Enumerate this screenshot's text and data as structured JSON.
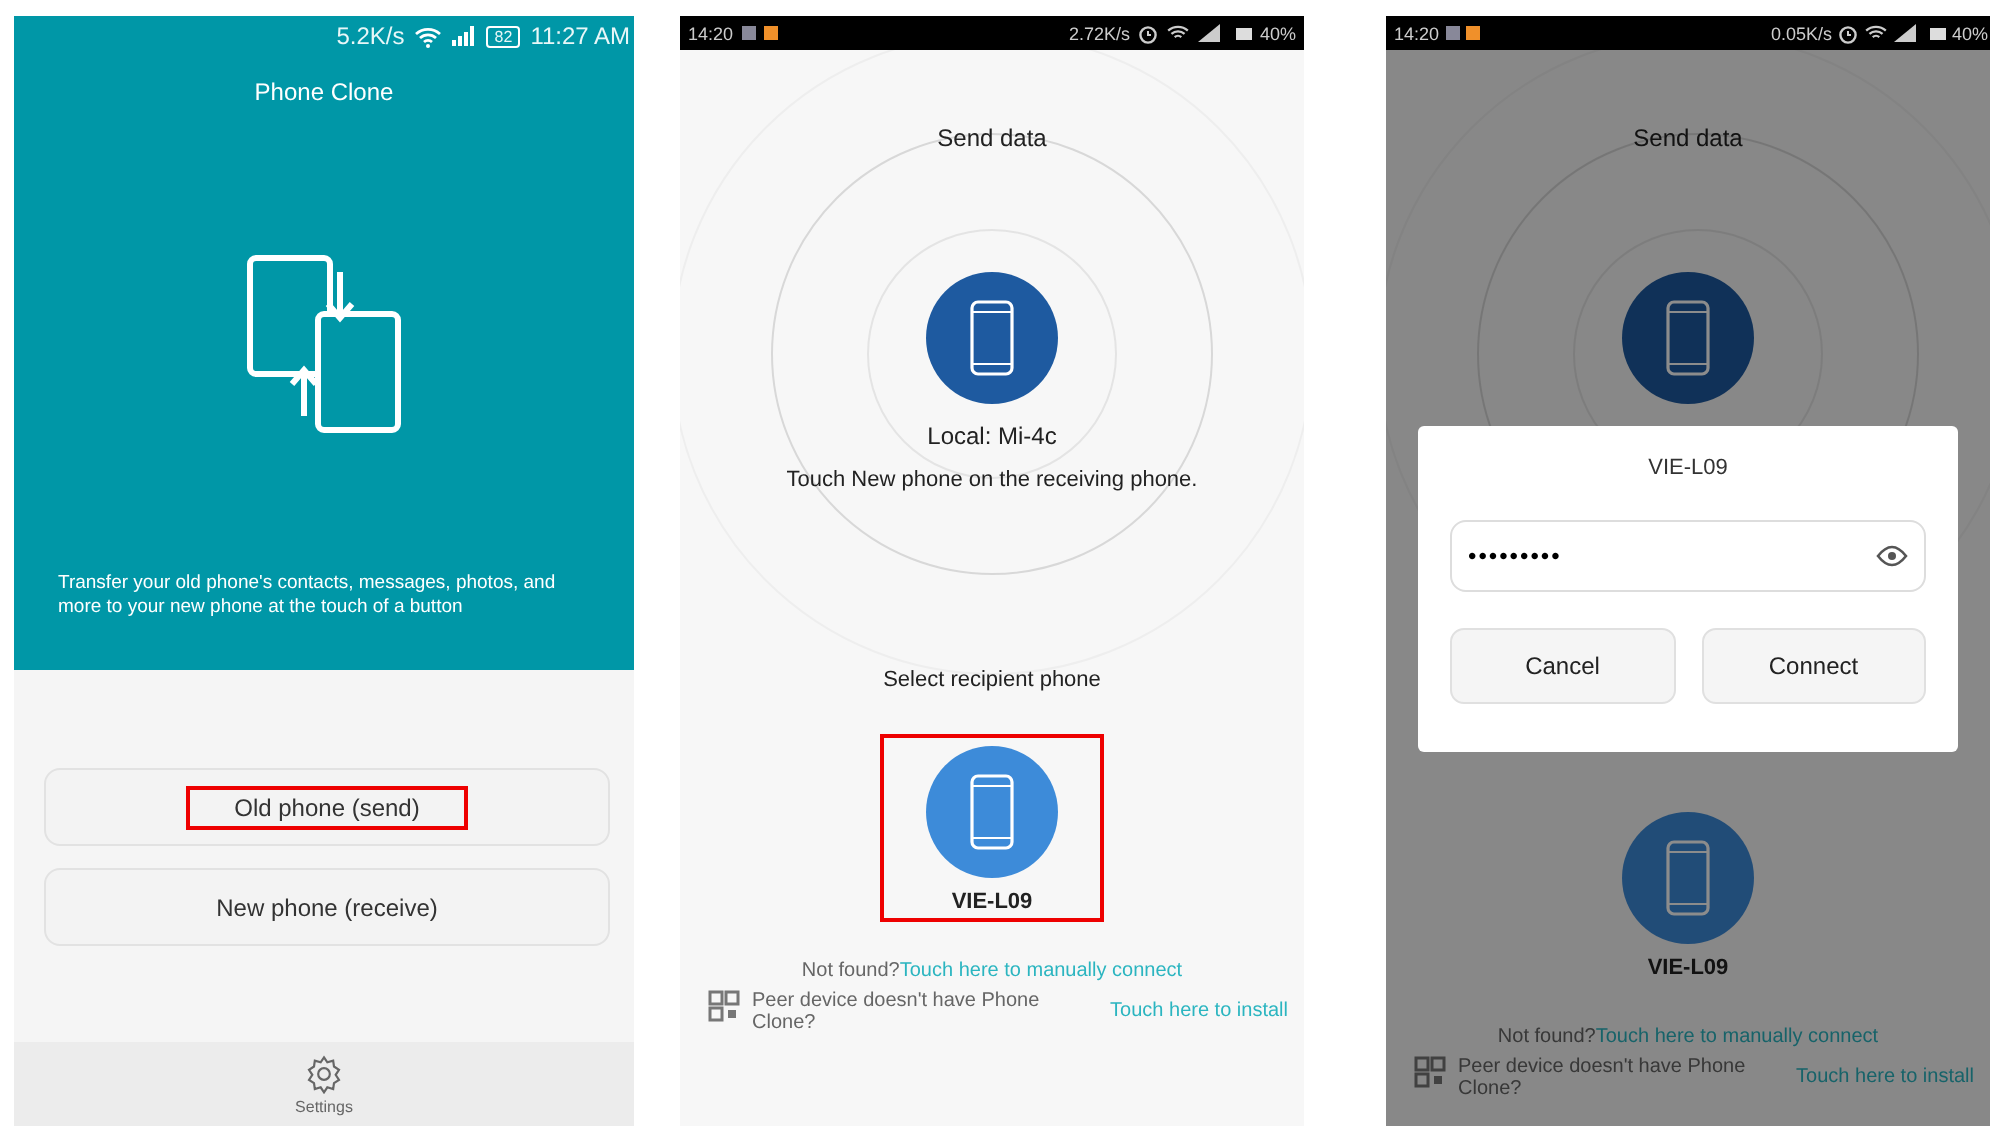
{
  "panels": [
    {
      "kind": "home",
      "status_bar": {
        "speed": "5.2K/s",
        "battery": "82",
        "time": "11:27 AM"
      },
      "title": "Phone Clone",
      "description": "Transfer your old phone's contacts, messages, photos, and more to your new phone at the touch of a button",
      "buttons": [
        {
          "label": "Old phone (send)",
          "highlighted": true
        },
        {
          "label": "New phone (receive)",
          "highlighted": false
        }
      ],
      "bottom_nav": {
        "label": "Settings"
      }
    },
    {
      "kind": "send",
      "status_bar": {
        "time": "14:20",
        "speed": "2.72K/s",
        "battery": "40%"
      },
      "title": "Send data",
      "local_label": "Local: Mi-4c",
      "hint": "Touch New phone on the receiving phone.",
      "section_label": "Select recipient phone",
      "recipients": [
        {
          "name": "VIE-L09",
          "highlighted": true
        }
      ],
      "not_found": "Not found?",
      "manual_link": "Touch here to manually connect",
      "install_prompt": "Peer device doesn't have Phone Clone?",
      "install_link": "Touch here to install"
    },
    {
      "kind": "send",
      "status_bar": {
        "time": "14:20",
        "speed": "0.05K/s",
        "battery": "40%"
      },
      "title": "Send data",
      "recipients": [
        {
          "name": "VIE-L09",
          "highlighted": false
        }
      ],
      "not_found": "Not found?",
      "manual_link": "Touch here to manually connect",
      "install_prompt": "Peer device doesn't have Phone Clone?",
      "install_link": "Touch here to install",
      "dialog": {
        "title": "VIE-L09",
        "password": "•••••••••",
        "buttons": [
          "Cancel",
          "Connect"
        ]
      }
    }
  ]
}
